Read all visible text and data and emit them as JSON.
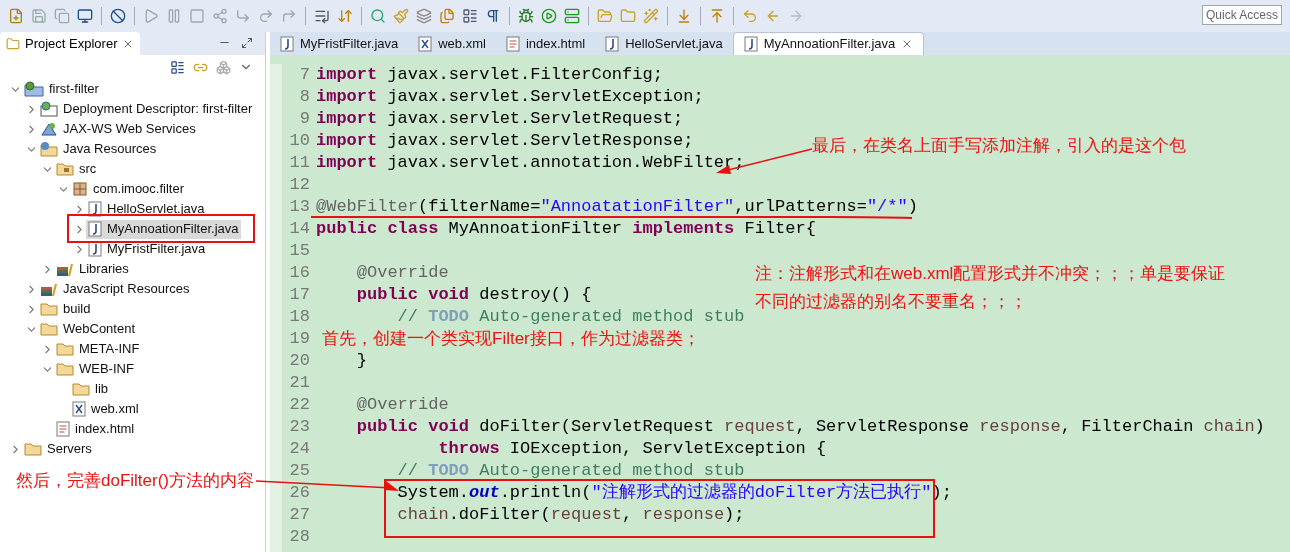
{
  "toolbar": {
    "quick_access": "Quick Access"
  },
  "project_explorer": {
    "title": "Project Explorer",
    "tree": [
      {
        "label": "first-filter",
        "kind": "project",
        "expanded": true,
        "selected": false,
        "children": [
          {
            "label": "Deployment Descriptor: first-filter",
            "kind": "descriptor",
            "expanded": false,
            "selected": false
          },
          {
            "label": "JAX-WS Web Services",
            "kind": "webservice",
            "expanded": false,
            "selected": false
          },
          {
            "label": "Java Resources",
            "kind": "javares",
            "expanded": true,
            "selected": false,
            "children": [
              {
                "label": "src",
                "kind": "srcfolder",
                "expanded": true,
                "selected": false,
                "children": [
                  {
                    "label": "com.imooc.filter",
                    "kind": "package",
                    "expanded": true,
                    "selected": false,
                    "children": [
                      {
                        "label": "HelloServlet.java",
                        "kind": "java",
                        "expanded": false,
                        "selected": false
                      },
                      {
                        "label": "MyAnnoationFilter.java",
                        "kind": "java",
                        "expanded": false,
                        "selected": true
                      },
                      {
                        "label": "MyFristFilter.java",
                        "kind": "java",
                        "expanded": false,
                        "selected": false
                      }
                    ]
                  }
                ]
              },
              {
                "label": "Libraries",
                "kind": "library",
                "expanded": false,
                "selected": false
              }
            ]
          },
          {
            "label": "JavaScript Resources",
            "kind": "library",
            "expanded": false,
            "selected": false
          },
          {
            "label": "build",
            "kind": "folder",
            "expanded": false,
            "selected": false
          },
          {
            "label": "WebContent",
            "kind": "folder",
            "expanded": true,
            "selected": false,
            "children": [
              {
                "label": "META-INF",
                "kind": "folder",
                "expanded": false,
                "selected": false
              },
              {
                "label": "WEB-INF",
                "kind": "folder",
                "expanded": true,
                "selected": false,
                "children": [
                  {
                    "label": "lib",
                    "kind": "folder",
                    "selected": false
                  },
                  {
                    "label": "web.xml",
                    "kind": "xml",
                    "selected": false
                  }
                ]
              },
              {
                "label": "index.html",
                "kind": "html",
                "selected": false
              }
            ]
          }
        ]
      },
      {
        "label": "Servers",
        "kind": "folder",
        "expanded": false,
        "selected": false
      }
    ]
  },
  "editor_tabs": [
    {
      "label": "MyFristFilter.java",
      "kind": "java",
      "selected": false
    },
    {
      "label": "web.xml",
      "kind": "xml",
      "selected": false
    },
    {
      "label": "index.html",
      "kind": "html",
      "selected": false
    },
    {
      "label": "HelloServlet.java",
      "kind": "java",
      "selected": false
    },
    {
      "label": "MyAnnoationFilter.java",
      "kind": "java",
      "selected": true
    }
  ],
  "code_lines": [
    {
      "number": "7",
      "tokens": [
        {
          "kind": "keyword",
          "text": "import"
        },
        {
          "kind": "plain",
          "text": " javax.servlet.FilterConfig;"
        }
      ]
    },
    {
      "number": "8",
      "tokens": [
        {
          "kind": "keyword",
          "text": "import"
        },
        {
          "kind": "plain",
          "text": " javax.servlet.ServletException;"
        }
      ]
    },
    {
      "number": "9",
      "tokens": [
        {
          "kind": "keyword",
          "text": "import"
        },
        {
          "kind": "plain",
          "text": " javax.servlet.ServletRequest;"
        }
      ]
    },
    {
      "number": "10",
      "tokens": [
        {
          "kind": "keyword",
          "text": "import"
        },
        {
          "kind": "plain",
          "text": " javax.servlet.ServletResponse;"
        }
      ]
    },
    {
      "number": "11",
      "tokens": [
        {
          "kind": "keyword",
          "text": "import"
        },
        {
          "kind": "plain",
          "text": " javax.servlet.annotation.WebFilter;"
        }
      ]
    },
    {
      "number": "12"
    },
    {
      "number": "13",
      "tokens": [
        {
          "kind": "annotation",
          "text": "@WebFilter"
        },
        {
          "kind": "plain",
          "text": "(filterName="
        },
        {
          "kind": "string",
          "text": "\"AnnoatationFilter\""
        },
        {
          "kind": "plain",
          "text": ",urlPatterns="
        },
        {
          "kind": "string",
          "text": "\"/*\""
        },
        {
          "kind": "plain",
          "text": ")"
        }
      ]
    },
    {
      "number": "14",
      "tokens": [
        {
          "kind": "keyword",
          "text": "public class"
        },
        {
          "kind": "plain",
          "text": " MyAnnoationFilter "
        },
        {
          "kind": "keyword",
          "text": "implements"
        },
        {
          "kind": "plain",
          "text": " Filter{"
        }
      ]
    },
    {
      "number": "15"
    },
    {
      "number": "16",
      "tokens": [
        {
          "kind": "annotation",
          "text": "    @Override"
        }
      ]
    },
    {
      "number": "17",
      "tokens": [
        {
          "kind": "keyword",
          "text": "    public void"
        },
        {
          "kind": "plain",
          "text": " destroy() {"
        }
      ]
    },
    {
      "number": "18",
      "tokens": [
        {
          "kind": "comment",
          "text": "        // "
        },
        {
          "kind": "todo",
          "text": "TODO"
        },
        {
          "kind": "comment",
          "text": " Auto-generated method stub"
        }
      ]
    },
    {
      "number": "19"
    },
    {
      "number": "20",
      "tokens": [
        {
          "kind": "plain",
          "text": "    }"
        }
      ]
    },
    {
      "number": "21"
    },
    {
      "number": "22",
      "tokens": [
        {
          "kind": "annotation",
          "text": "    @Override"
        }
      ]
    },
    {
      "number": "23",
      "tokens": [
        {
          "kind": "keyword",
          "text": "    public void"
        },
        {
          "kind": "plain",
          "text": " doFilter(ServletRequest "
        },
        {
          "kind": "param",
          "text": "request"
        },
        {
          "kind": "plain",
          "text": ", ServletResponse "
        },
        {
          "kind": "param",
          "text": "response"
        },
        {
          "kind": "plain",
          "text": ", FilterChain "
        },
        {
          "kind": "param",
          "text": "chain"
        },
        {
          "kind": "plain",
          "text": ")"
        }
      ]
    },
    {
      "number": "24",
      "tokens": [
        {
          "kind": "keyword",
          "text": "            throws"
        },
        {
          "kind": "plain",
          "text": " IOException, ServletException {"
        }
      ]
    },
    {
      "number": "25",
      "tokens": [
        {
          "kind": "comment",
          "text": "        // "
        },
        {
          "kind": "todo",
          "text": "TODO"
        },
        {
          "kind": "comment",
          "text": " Auto-generated method stub"
        }
      ]
    },
    {
      "number": "26",
      "tokens": [
        {
          "kind": "plain",
          "text": "        System."
        },
        {
          "kind": "field",
          "text": "out"
        },
        {
          "kind": "plain",
          "text": ".println("
        },
        {
          "kind": "string",
          "text": "\"注解形式的过滤器的doFilter方法已执行\""
        },
        {
          "kind": "plain",
          "text": ");"
        }
      ]
    },
    {
      "number": "27",
      "tokens": [
        {
          "kind": "param",
          "text": "        chain"
        },
        {
          "kind": "plain",
          "text": ".doFilter("
        },
        {
          "kind": "param",
          "text": "request"
        },
        {
          "kind": "plain",
          "text": ", "
        },
        {
          "kind": "param",
          "text": "response"
        },
        {
          "kind": "plain",
          "text": ");"
        }
      ]
    },
    {
      "number": "28"
    }
  ],
  "annotations": [
    {
      "text": "最后，在类名上面手写添加注解，引入的是这个包"
    },
    {
      "text": "注：注解形式和在web.xml配置形式并不冲突；；；单是要保证"
    },
    {
      "text": "不同的过滤器的别名不要重名；；；"
    },
    {
      "text": "首先，创建一个类实现Filter接口，作为过滤器类；"
    },
    {
      "text": "然后，完善doFilter()方法的内容"
    }
  ]
}
